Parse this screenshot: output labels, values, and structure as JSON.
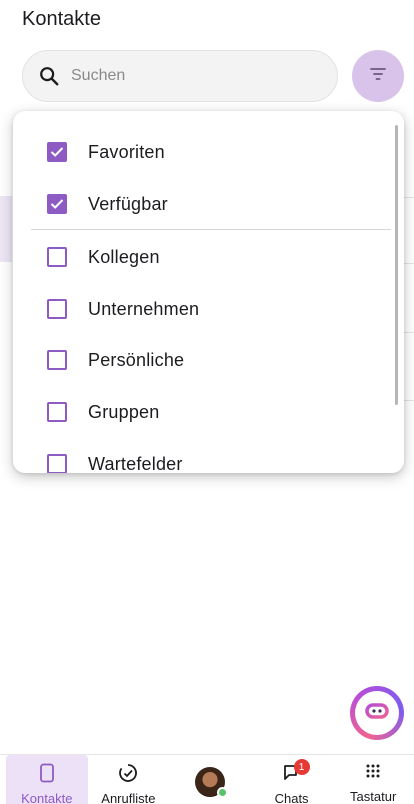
{
  "header": {
    "title": "Kontakte"
  },
  "search": {
    "placeholder": "Suchen"
  },
  "filter_menu": {
    "options": [
      {
        "label": "Favoriten",
        "checked": true
      },
      {
        "label": "Verfügbar",
        "checked": true
      },
      {
        "label": "Kollegen",
        "checked": false
      },
      {
        "label": "Unternehmen",
        "checked": false
      },
      {
        "label": "Persönliche",
        "checked": false
      },
      {
        "label": "Gruppen",
        "checked": false
      },
      {
        "label": "Wartefelder",
        "checked": false
      }
    ]
  },
  "bottom_nav": {
    "items": [
      {
        "label": "Kontakte",
        "icon": "contacts-icon",
        "active": true
      },
      {
        "label": "Anrufliste",
        "icon": "call-history-icon",
        "active": false
      },
      {
        "label": "",
        "icon": "avatar",
        "active": false
      },
      {
        "label": "Chats",
        "icon": "chat-icon",
        "badge": "1",
        "active": false
      },
      {
        "label": "Tastatur",
        "icon": "dialpad-icon",
        "active": false
      }
    ]
  },
  "colors": {
    "accent": "#8e5bc3",
    "filter_button_bg": "#d9c3ea",
    "badge": "#e53935",
    "presence": "#58c26b"
  }
}
